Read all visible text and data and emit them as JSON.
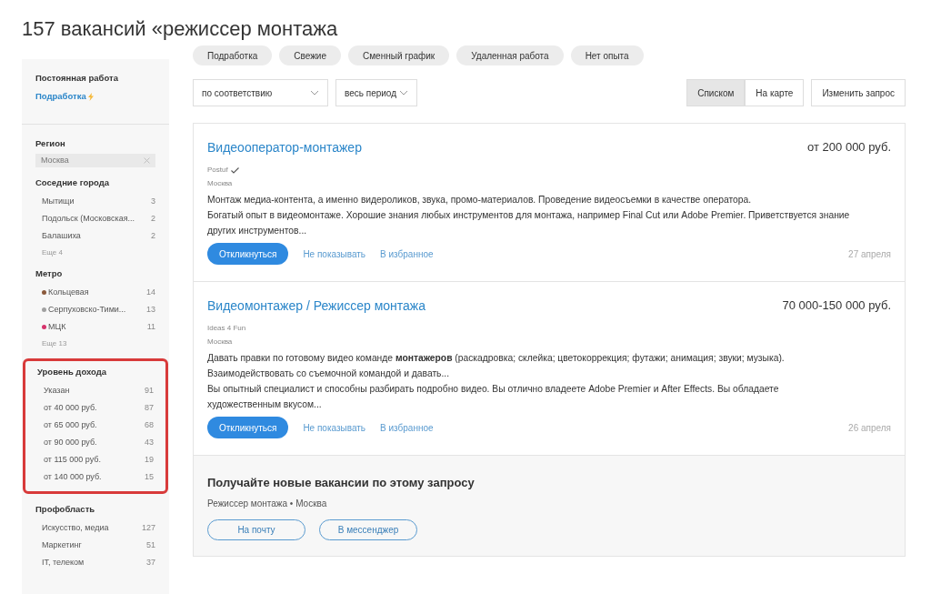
{
  "title": "157 вакансий «режиссер монтажа",
  "sidebar": {
    "employment": {
      "current": "Постоянная работа",
      "link": "Подработка"
    },
    "sections": [
      {
        "kind": "chip",
        "title": "Регион",
        "chip": "Москва",
        "highlighted": false
      },
      {
        "kind": "counts",
        "title": "Соседние города",
        "highlighted": false,
        "items": [
          {
            "label": "Мытищи",
            "count": "3"
          },
          {
            "label": "Подольск (Московская...",
            "count": "2"
          },
          {
            "label": "Балашиха",
            "count": "2"
          }
        ],
        "more": "Еще 4"
      },
      {
        "kind": "counts",
        "title": "Метро",
        "highlighted": false,
        "items": [
          {
            "label": "Кольцевая",
            "count": "14",
            "color": "#8b5a3c"
          },
          {
            "label": "Серпуховско-Тими...",
            "count": "13",
            "color": "#a0a0a0"
          },
          {
            "label": "МЦК",
            "count": "11",
            "color": "#d6336c"
          }
        ],
        "more": "Еще 13"
      },
      {
        "kind": "counts",
        "title": "Уровень дохода",
        "highlighted": true,
        "items": [
          {
            "label": "Указан",
            "count": "91"
          },
          {
            "label": "от 40 000 руб.",
            "count": "87"
          },
          {
            "label": "от 65 000 руб.",
            "count": "68"
          },
          {
            "label": "от 90 000 руб.",
            "count": "43"
          },
          {
            "label": "от 115 000 руб.",
            "count": "19"
          },
          {
            "label": "от 140 000 руб.",
            "count": "15"
          }
        ]
      },
      {
        "kind": "counts",
        "title": "Профобласть",
        "highlighted": false,
        "items": [
          {
            "label": "Искусство, медиа",
            "count": "127"
          },
          {
            "label": "Маркетинг",
            "count": "51"
          },
          {
            "label": "IT, телеком",
            "count": "37"
          }
        ]
      }
    ]
  },
  "filters": [
    "Подработка",
    "Свежие",
    "Сменный график",
    "Удаленная работа",
    "Нет опыта"
  ],
  "sort": {
    "order": "по соответствию",
    "period": "весь период"
  },
  "view_tabs": [
    {
      "label": "Списком",
      "selected": true
    },
    {
      "label": "На карте",
      "selected": false
    }
  ],
  "change_query": "Изменить запрос",
  "vacancies": [
    {
      "title": "Видеооператор-монтажер",
      "salary": "от 200 000 руб.",
      "company": "Postuf",
      "verified": true,
      "city": "Москва",
      "description": [
        "Монтаж медиа-контента, а именно видероликов, звука, промо-материалов. Проведение видеосъемки в качестве оператора.",
        "Богатый опыт в видеомонтаже. Хорошие знания любых инструментов для монтажа, например Final Cut или Adobe Premier. Приветствуется знание других инструментов..."
      ],
      "respond": "Откликнуться",
      "hide": "Не показывать",
      "favorite": "В избранное",
      "date": "27 апреля"
    },
    {
      "title": "Видеомонтажер / Режиссер монтажа",
      "salary": "70 000-150 000 руб.",
      "company": "Ideas 4 Fun",
      "verified": false,
      "city": "Москва",
      "description": [
        "Давать правки по готовому видео команде **монтажеров** (раскадровка; склейка; цветокоррекция; футажи; анимация; звуки; музыка). Взаимодействовать со съемочной командой и давать...",
        "Вы опытный специалист и способны разбирать подробно видео. Вы отлично владеете Adobe Premier и After Effects. Вы обладаете художественным вкусом..."
      ],
      "respond": "Откликнуться",
      "hide": "Не показывать",
      "favorite": "В избранное",
      "date": "26 апреля"
    }
  ],
  "subscribe": {
    "title": "Получайте новые вакансии по этому запросу",
    "subtitle": "Режиссер монтажа • Москва",
    "buttons": [
      "На почту",
      "В мессенджер"
    ]
  }
}
